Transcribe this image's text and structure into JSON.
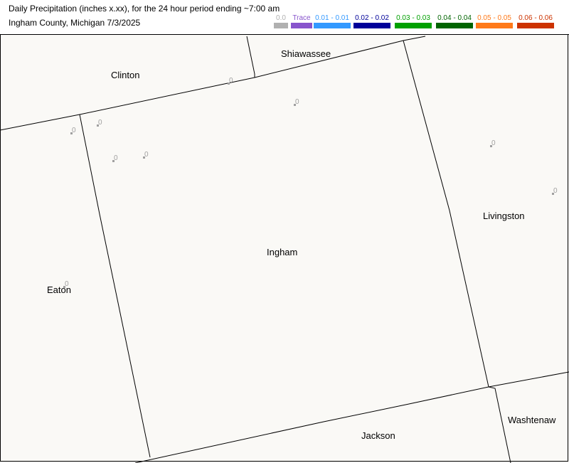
{
  "header": {
    "title": "Daily Precipitation (inches  x.xx),  for the 24 hour period ending ~7:00 am",
    "subtitle": "Ingham County, Michigan  7/3/2025"
  },
  "legend": [
    {
      "label": "0.0",
      "color": "#b0b0b0"
    },
    {
      "label": "Trace",
      "color": "#8855cc"
    },
    {
      "label": "0.01 - 0.01",
      "color": "#3399ff"
    },
    {
      "label": "0.02 - 0.02",
      "color": "#000099"
    },
    {
      "label": "0.03 - 0.03",
      "color": "#00a000"
    },
    {
      "label": "0.04 - 0.04",
      "color": "#006400"
    },
    {
      "label": "0.05 - 0.05",
      "color": "#ff7a1a"
    },
    {
      "label": "0.06 - 0.06",
      "color": "#cc3300"
    }
  ],
  "counties": {
    "clinton": "Clinton",
    "shiawassee": "Shiawassee",
    "ingham": "Ingham",
    "livingston": "Livingston",
    "eaton": "Eaton",
    "washtenaw": "Washtenaw",
    "jackson": "Jackson"
  },
  "stations": [
    {
      "value": "0"
    },
    {
      "value": "0"
    },
    {
      "value": "0"
    },
    {
      "value": "0"
    },
    {
      "value": "0"
    },
    {
      "value": "0"
    },
    {
      "value": "0"
    },
    {
      "value": "0"
    },
    {
      "value": "0"
    }
  ]
}
